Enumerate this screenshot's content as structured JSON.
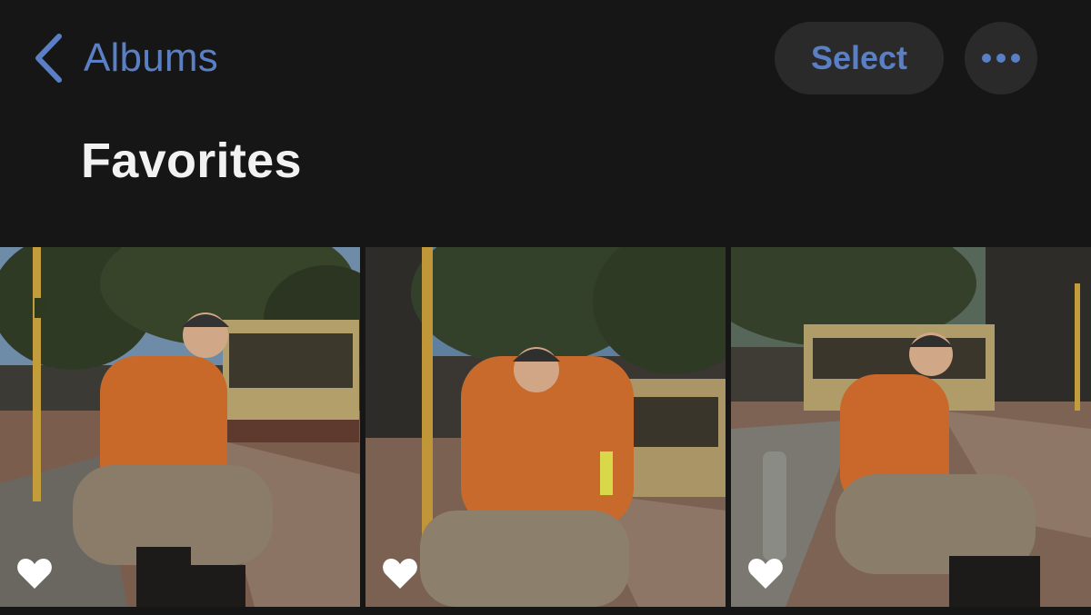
{
  "nav": {
    "back_label": "Albums",
    "back_icon": "chevron-left-icon",
    "select_label": "Select",
    "more_icon": "ellipsis-icon",
    "accent_color": "#5b7fc4"
  },
  "page": {
    "title": "Favorites"
  },
  "photos": [
    {
      "favorite": true,
      "heart_icon": "heart-filled-icon"
    },
    {
      "favorite": true,
      "heart_icon": "heart-filled-icon"
    },
    {
      "favorite": true,
      "heart_icon": "heart-filled-icon"
    }
  ]
}
